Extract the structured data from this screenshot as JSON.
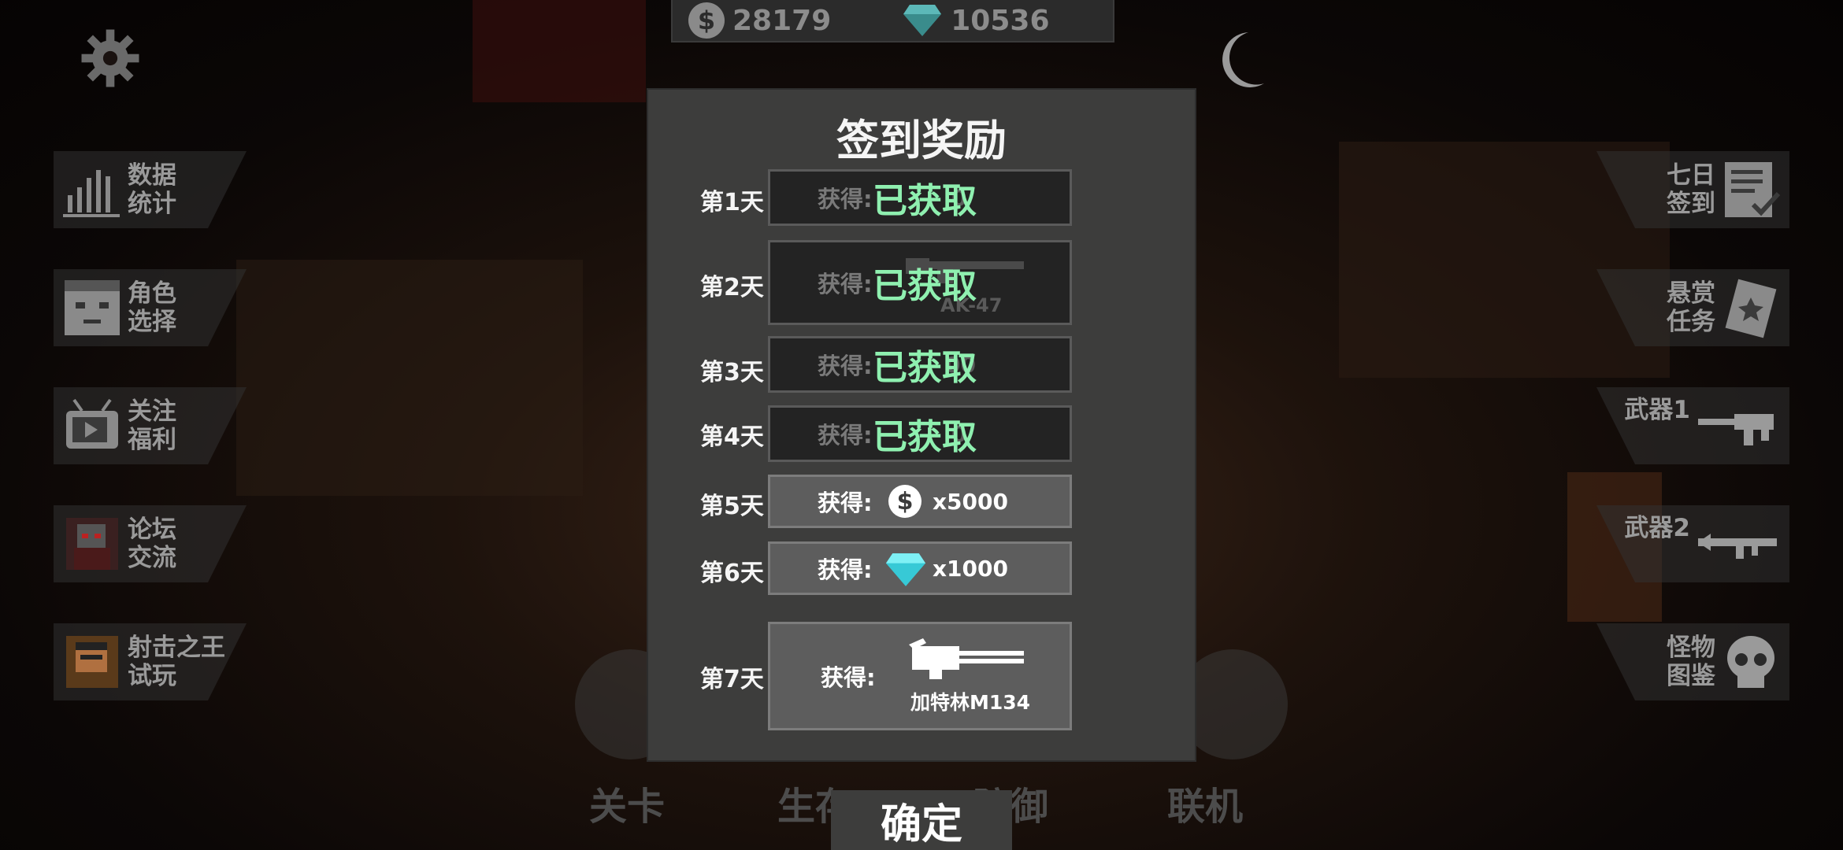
{
  "currency": {
    "coins": "28179",
    "gems": "10536"
  },
  "left_menu": [
    {
      "label": "数据\n统计",
      "icon": "bar-chart-icon"
    },
    {
      "label": "角色\n选择",
      "icon": "character-face-icon"
    },
    {
      "label": "关注\n福利",
      "icon": "tv-icon"
    },
    {
      "label": "论坛\n交流",
      "icon": "avatar-icon"
    },
    {
      "label": "射击之王\n试玩",
      "icon": "game-avatar-icon"
    }
  ],
  "right_menu": [
    {
      "label": "七日\n签到",
      "icon": "checklist-icon"
    },
    {
      "label": "悬赏\n任务",
      "icon": "bounty-card-icon"
    },
    {
      "label": "武器1",
      "icon": "rifle-icon"
    },
    {
      "label": "武器2",
      "icon": "rocket-launcher-icon"
    },
    {
      "label": "怪物\n图鉴",
      "icon": "skull-icon"
    }
  ],
  "modes": [
    "关卡",
    "生存",
    "防御",
    "联机"
  ],
  "dialog": {
    "title": "签到奖励",
    "get_label": "获得:",
    "claimed_label": "已获取",
    "confirm": "确定",
    "days": [
      {
        "day": "第1天",
        "faded": "0"
      },
      {
        "day": "第2天",
        "item": "AK-47"
      },
      {
        "day": "第3天",
        "faded": "00"
      },
      {
        "day": "第4天",
        "faded": "0"
      },
      {
        "day": "第5天",
        "amount": "x5000"
      },
      {
        "day": "第6天",
        "amount": "x1000"
      },
      {
        "day": "第7天",
        "item": "加特林M134"
      }
    ]
  },
  "colors": {
    "claimed_text": "#8ff0b0",
    "panel": "#3d3d3c"
  }
}
